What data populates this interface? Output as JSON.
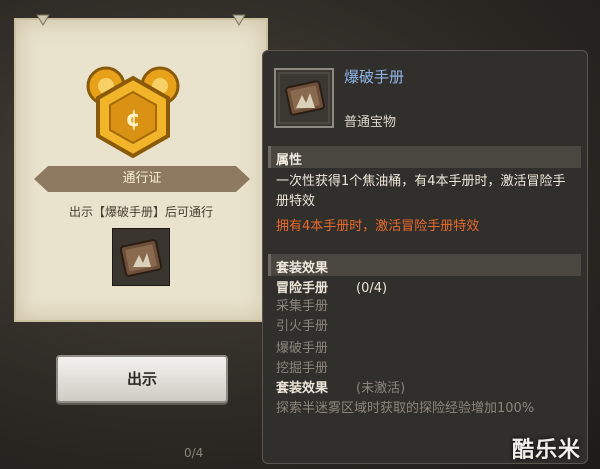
{
  "pass_panel": {
    "ribbon_label": "通行证",
    "description": "出示【爆破手册】后可通行",
    "show_button": "出示"
  },
  "background": {
    "counter": "0/4"
  },
  "item": {
    "name": "爆破手册",
    "type": "普通宝物",
    "attributes_title": "属性",
    "attributes_text": "一次性获得1个焦油桶，有4本手册时，激活冒险手册特效",
    "highlight_text": "拥有4本手册时，激活冒险手册特效"
  },
  "set_effect": {
    "title": "套装效果",
    "set_name": "冒险手册",
    "set_count": "(0/4)",
    "members": [
      "采集手册",
      "引火手册",
      "爆破手册",
      "挖掘手册"
    ],
    "effect_label": "套装效果",
    "effect_status": "(未激活)",
    "effect_desc": "探索半迷雾区域时获取的探险经验增加100%"
  },
  "watermark": "酷乐米",
  "colors": {
    "item_name": "#8fb4e8",
    "highlight": "#e86a2c",
    "inactive": "#8b857b"
  }
}
